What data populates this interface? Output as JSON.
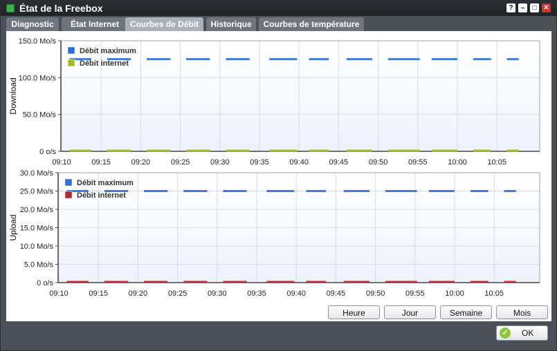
{
  "window": {
    "title": "État de la Freebox"
  },
  "window_controls": {
    "help": "?",
    "minimize": "–",
    "maximize": "□",
    "close": "✕"
  },
  "tabs": [
    {
      "label": "Diagnostic",
      "active": false
    },
    {
      "label": "État Internet",
      "active": false
    },
    {
      "label": "Courbes de Débit",
      "active": true
    },
    {
      "label": "Historique",
      "active": false
    },
    {
      "label": "Courbes de température",
      "active": false
    }
  ],
  "range_buttons": [
    "Heure",
    "Jour",
    "Semaine",
    "Mois"
  ],
  "ok_label": "OK",
  "chart_data": [
    {
      "type": "line",
      "ylabel": "Download",
      "x_ticks": [
        "09:10",
        "09:15",
        "09:20",
        "09:25",
        "09:30",
        "09:35",
        "09:40",
        "09:45",
        "09:50",
        "09:55",
        "10:00",
        "10:05"
      ],
      "y_ticks": [
        "150.0 Mo/s",
        "100.0 Mo/s",
        "50.0 Mo/s",
        "0 o/s"
      ],
      "ylim": [
        0,
        150
      ],
      "y_unit": "Mo/s",
      "grid": true,
      "legend_position": "top-left",
      "series": [
        {
          "name": "Débit maximum",
          "color": "#2f6fd6",
          "value": 125
        },
        {
          "name": "Débit internet",
          "color": "#9cc21a",
          "value": 0
        }
      ]
    },
    {
      "type": "line",
      "ylabel": "Upload",
      "x_ticks": [
        "09:10",
        "09:15",
        "09:20",
        "09:25",
        "09:30",
        "09:35",
        "09:40",
        "09:45",
        "09:50",
        "09:55",
        "10:00",
        "10:05"
      ],
      "y_ticks": [
        "30.0 Mo/s",
        "25.0 Mo/s",
        "20.0 Mo/s",
        "15.0 Mo/s",
        "10.0 Mo/s",
        "5.0 Mo/s",
        "0 o/s"
      ],
      "ylim": [
        0,
        30
      ],
      "y_unit": "Mo/s",
      "grid": true,
      "legend_position": "top-left",
      "series": [
        {
          "name": "Débit maximum",
          "color": "#2f6fd6",
          "value": 25
        },
        {
          "name": "Débit internet",
          "color": "#b8242e",
          "value": 0
        }
      ]
    }
  ]
}
